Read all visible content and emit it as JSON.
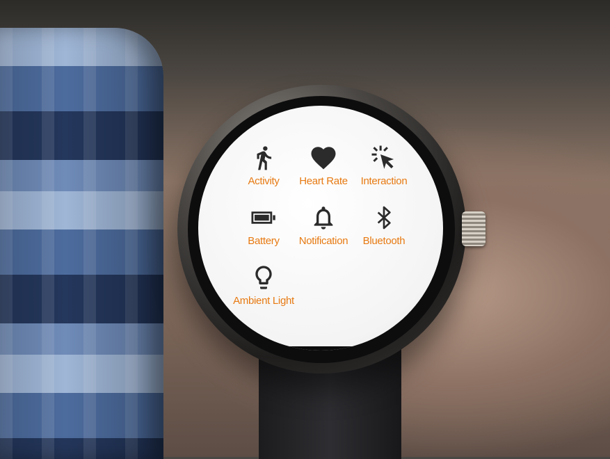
{
  "watch": {
    "menu": [
      {
        "id": "activity",
        "label": "Activity",
        "icon": "running-person-icon"
      },
      {
        "id": "heart-rate",
        "label": "Heart Rate",
        "icon": "heart-icon"
      },
      {
        "id": "interaction",
        "label": "Interaction",
        "icon": "tap-cursor-icon"
      },
      {
        "id": "battery",
        "label": "Battery",
        "icon": "battery-icon"
      },
      {
        "id": "notification",
        "label": "Notification",
        "icon": "bell-icon"
      },
      {
        "id": "bluetooth",
        "label": "Bluetooth",
        "icon": "bluetooth-icon"
      },
      {
        "id": "ambient-light",
        "label": "Ambient Light",
        "icon": "lightbulb-icon"
      }
    ],
    "colors": {
      "label": "#e77a12",
      "icon": "#2b2b2b",
      "screen": "#ffffff"
    }
  }
}
